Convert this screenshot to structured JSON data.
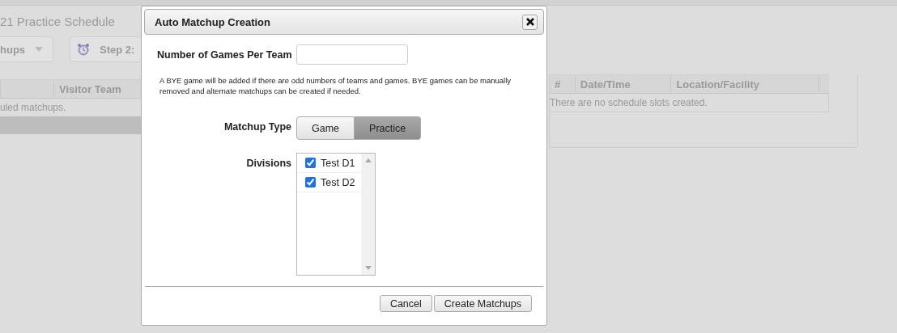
{
  "background": {
    "page_title": "21 Practice Schedule",
    "buttons": [
      {
        "label": "hups",
        "kind": "dropdown"
      },
      {
        "label": "Step 2:",
        "kind": "step"
      }
    ],
    "matchups_table": {
      "columns": [
        "Visitor Team"
      ],
      "empty_message": "uled matchups."
    },
    "slots_table": {
      "columns": [
        "#",
        "Date/Time",
        "Location/Facility"
      ],
      "empty_message": "There are no schedule slots created."
    }
  },
  "dialog": {
    "title": "Auto Matchup Creation",
    "games_per_team": {
      "label": "Number of Games Per Team"
    },
    "note": "A BYE game will be added if there are odd numbers of teams and games. BYE games can be manually removed and alternate matchups can be created if needed.",
    "matchup_type": {
      "label": "Matchup Type",
      "options": [
        {
          "label": "Game",
          "selected": false
        },
        {
          "label": "Practice",
          "selected": true
        }
      ]
    },
    "divisions": {
      "label": "Divisions",
      "items": [
        {
          "label": "Test D1",
          "checked": true
        },
        {
          "label": "Test D2",
          "checked": true
        }
      ]
    },
    "buttons": [
      "Cancel",
      "Create Matchups"
    ]
  }
}
